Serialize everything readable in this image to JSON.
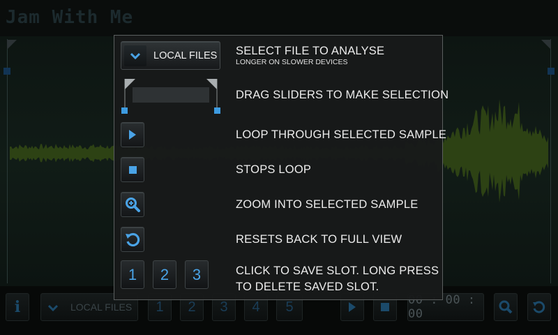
{
  "app": {
    "title": "Jam With Me",
    "accent_color": "#3d9be0",
    "waveform_color": "#2d4214"
  },
  "toolbar": {
    "info_icon": "info-icon",
    "source_label": "LOCAL FILES",
    "slots": [
      "1",
      "2",
      "3",
      "4",
      "5"
    ],
    "timer": "00 : 00 : 00"
  },
  "help": {
    "local_files_label": "LOCAL FILES",
    "rows": [
      {
        "icon": "chevron-down-icon",
        "text": "SELECT FILE TO ANALYSE",
        "subtext": "LONGER ON SLOWER DEVICES"
      },
      {
        "icon": "selection-sliders-icon",
        "text": "DRAG SLIDERS TO MAKE SELECTION"
      },
      {
        "icon": "play-icon",
        "text": "LOOP THROUGH SELECTED SAMPLE"
      },
      {
        "icon": "stop-icon",
        "text": "STOPS LOOP"
      },
      {
        "icon": "zoom-in-icon",
        "text": "ZOOM INTO SELECTED SAMPLE"
      },
      {
        "icon": "reset-icon",
        "text": "RESETS BACK TO FULL VIEW"
      },
      {
        "icon": "save-slot-icon",
        "text": "CLICK TO SAVE SLOT. LONG PRESS",
        "text2": "TO DELETE SAVED SLOT."
      }
    ],
    "slots": [
      "1",
      "2",
      "3"
    ]
  }
}
